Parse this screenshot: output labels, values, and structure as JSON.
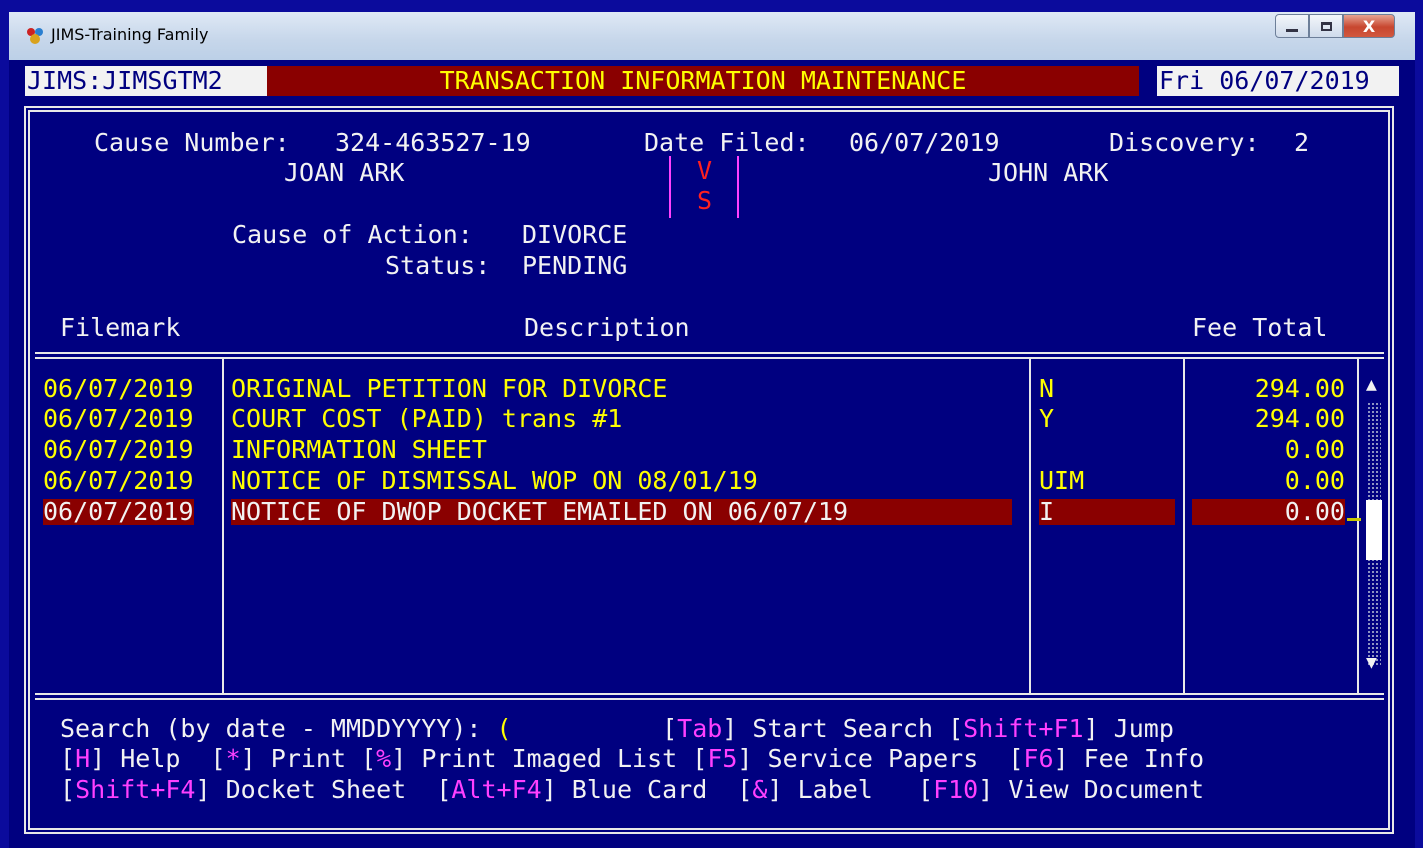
{
  "window": {
    "title": "JIMS-Training Family",
    "icon": "jims-app-icon",
    "controls": {
      "minimize": "—",
      "maximize": "▢",
      "close": "X"
    }
  },
  "header": {
    "program_id": "JIMS:JIMSGTM2",
    "screen_title": "TRANSACTION INFORMATION MAINTENANCE",
    "date": "Fri 06/07/2019"
  },
  "case": {
    "cause_number_label": "Cause Number:",
    "cause_number": "324-463527-19",
    "date_filed_label": "Date Filed:",
    "date_filed": "06/07/2019",
    "discovery_label": "Discovery:",
    "discovery": "2",
    "plaintiff": "JOAN ARK",
    "vs_v": "V",
    "vs_s": "S",
    "defendant": "JOHN ARK",
    "cause_of_action_label": "Cause of Action:",
    "cause_of_action": "DIVORCE",
    "status_label": "Status:",
    "status": "PENDING"
  },
  "table": {
    "columns": {
      "filemark": "Filemark",
      "description": "Description",
      "fee_total": "Fee Total"
    },
    "rows": [
      {
        "filemark": "06/07/2019",
        "description": "ORIGINAL PETITION FOR DIVORCE",
        "code": "N",
        "fee": "294.00",
        "selected": false
      },
      {
        "filemark": "06/07/2019",
        "description": "COURT COST (PAID) trans #1",
        "code": "Y",
        "fee": "294.00",
        "selected": false
      },
      {
        "filemark": "06/07/2019",
        "description": "INFORMATION SHEET",
        "code": "",
        "fee": "0.00",
        "selected": false
      },
      {
        "filemark": "06/07/2019",
        "description": "NOTICE OF DISMISSAL WOP ON 08/01/19",
        "code": "UIM",
        "fee": "0.00",
        "selected": false
      },
      {
        "filemark": "06/07/2019",
        "description": "NOTICE OF DWOP DOCKET EMAILED ON 06/07/19",
        "code": "I",
        "fee": "0.00",
        "selected": true
      }
    ]
  },
  "footer": {
    "search_label": "Search (by date - MMDDYYYY):",
    "search_value": "(",
    "tab_key": "Tab",
    "tab_label": "Start Search",
    "jump_key": "Shift+F1",
    "jump_label": "Jump",
    "help_key": "H",
    "help_label": "Help",
    "print_key": "*",
    "print_label": "Print",
    "print_imaged_key": "%",
    "print_imaged_label": "Print Imaged List",
    "service_key": "F5",
    "service_label": "Service Papers",
    "fee_key": "F6",
    "fee_label": "Fee Info",
    "docket_key": "Shift+F4",
    "docket_label": "Docket Sheet",
    "bluecard_key": "Alt+F4",
    "bluecard_label": "Blue Card",
    "label_key": "&",
    "label_label": "Label",
    "view_key": "F10",
    "view_label": "View Document"
  },
  "colors": {
    "background": "#000080",
    "header_red": "#8a0000",
    "highlight_text": "#ffff00",
    "hotkey": "#ff40ff"
  }
}
